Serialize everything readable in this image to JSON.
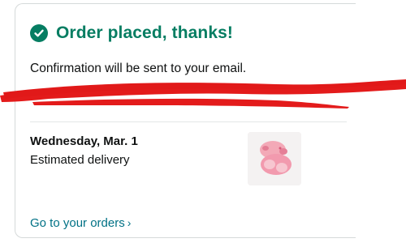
{
  "header": {
    "title": "Order placed, thanks!",
    "icon": "check-circle-icon",
    "accent_color": "#067d62"
  },
  "confirmation_text": "Confirmation will be sent to your email.",
  "delivery": {
    "date": "Wednesday, Mar. 1",
    "label": "Estimated delivery",
    "product_image": "product-thumbnail"
  },
  "orders_link": {
    "label": "Go to your orders",
    "chevron": "›",
    "color": "#007185"
  },
  "redaction_color": "#e31b1b"
}
